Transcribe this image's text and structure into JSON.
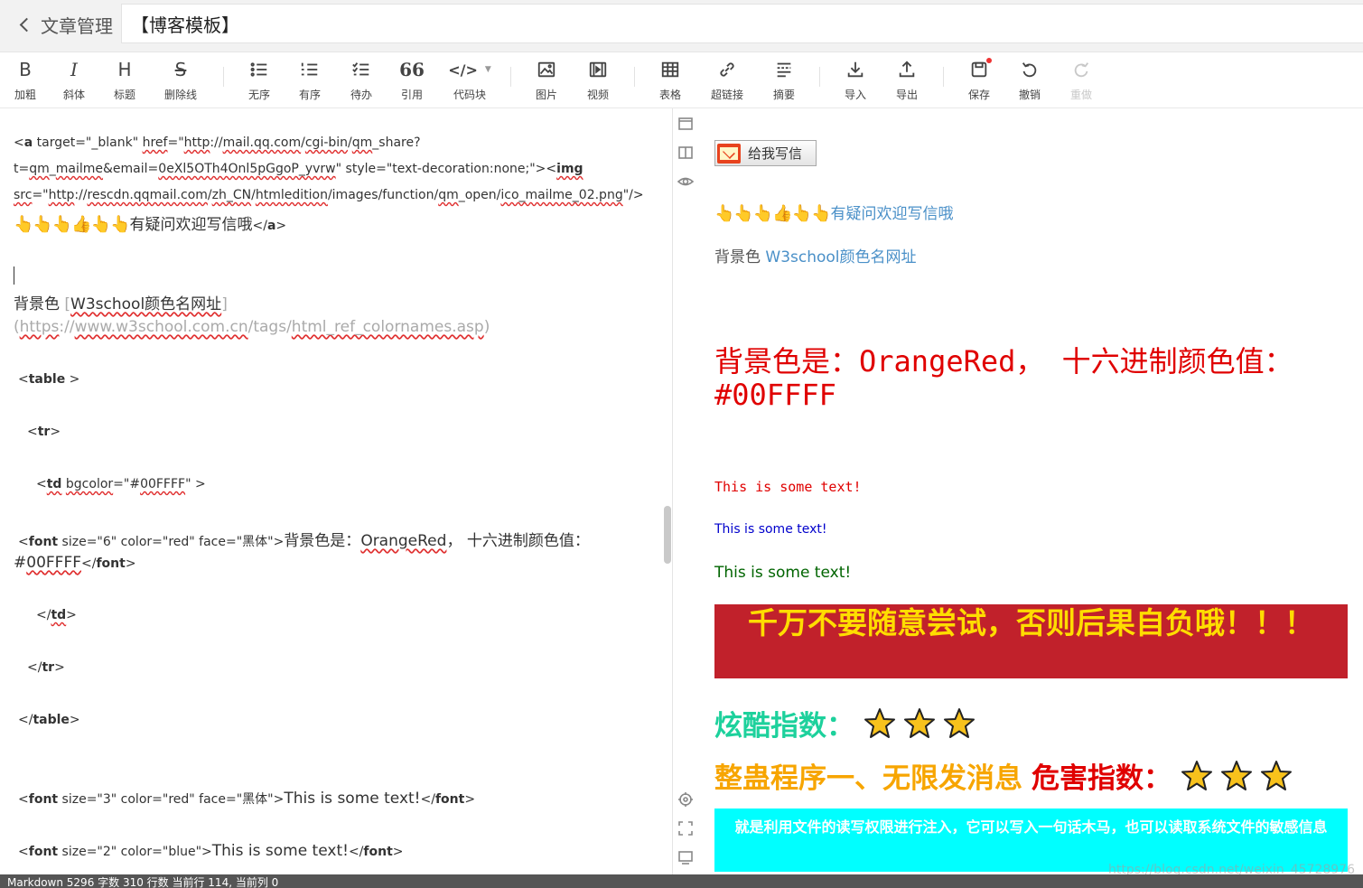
{
  "header": {
    "back_label": "文章管理",
    "title_value": "【博客模板】"
  },
  "toolbar": {
    "bold": "加粗",
    "italic": "斜体",
    "heading": "标题",
    "strike": "删除线",
    "unordered": "无序",
    "ordered": "有序",
    "todo": "待办",
    "quote": "引用",
    "codeblock": "代码块",
    "image": "图片",
    "video": "视频",
    "table": "表格",
    "link": "超链接",
    "summary": "摘要",
    "import": "导入",
    "export": "导出",
    "save": "保存",
    "undo": "撤销",
    "redo": "重做",
    "icon_bold": "B",
    "icon_italic": "I",
    "icon_heading": "H",
    "icon_strike": "S",
    "icon_quote": "66",
    "icon_code": "</>"
  },
  "editor": {
    "l1a": "<",
    "l1b": "a",
    "l1c": " target=\"_blank\" ",
    "l1d": "href",
    "l1e": "=\"",
    "l1f": "http",
    "l1g": "://",
    "l1h": "mail.qq.com",
    "l1i": "/",
    "l1j": "cgi-bin",
    "l1k": "/",
    "l1l": "qm",
    "l1m": "_share?",
    "l2a": "t=",
    "l2b": "qm",
    "l2c": "_",
    "l2d": "mailme",
    "l2e": "&email=",
    "l2f": "0eXl5OTh4Onl5pGgoP_yvrw",
    "l2g": "\" style=\"text-decoration:none;\"><",
    "l2h": "img",
    "l3a": "src",
    "l3b": "=\"",
    "l3c": "http",
    "l3d": "://",
    "l3e": "rescdn.qqmail.com",
    "l3f": "/",
    "l3g": "zh_CN",
    "l3h": "/",
    "l3i": "htmledition",
    "l3j": "/images/function/",
    "l3k": "qm",
    "l3l": "_open/",
    "l3m": "ico_mailme_02.png",
    "l3n": "\"/>",
    "l4_emoji": "👆👆👆👍👆👆",
    "l4_text": "有疑问欢迎写信哦",
    "l4_close": "</",
    "l4_tag": "a",
    "l4_end": ">",
    "l6_a": "背景色 ",
    "l6_b": "[",
    "l6_c": "W3school颜色名网址",
    "l6_d": "]",
    "l7_a": "(",
    "l7_b": "https",
    "l7_c": "://",
    "l7_d": "www.w3school.com.cn",
    "l7_e": "/tags/",
    "l7_f": "html_ref_colornames.asp",
    "l7_g": ")",
    "l8_a": "<",
    "l8_b": "table",
    "l8_c": " >",
    "l9_a": "<",
    "l9_b": "tr",
    "l9_c": ">",
    "l10_a": "<",
    "l10_b": "td",
    "l10_c": " ",
    "l10_d": "bgcolor",
    "l10_e": "=\"#",
    "l10_f": "00FFFF",
    "l10_g": "\" >",
    "l11_a": "<",
    "l11_b": "font",
    "l11_c": " size=\"6\" color=\"red\" face=\"黑体\">",
    "l11_d": "背景色是：",
    "l11_e": "OrangeRed",
    "l11_f": "，  十六进制颜色值：",
    "l12_a": "#",
    "l12_b": "00FFFF",
    "l12_c": "</",
    "l12_d": "font",
    "l12_e": ">",
    "l13_a": "</",
    "l13_b": "td",
    "l13_c": ">",
    "l14_a": "</",
    "l14_b": "tr",
    "l14_c": ">",
    "l15_a": "</",
    "l15_b": "table",
    "l15_c": ">",
    "l16_a": "<",
    "l16_b": "font",
    "l16_c": " size=\"3\" color=\"red\" face=\"黑体\">",
    "l16_d": "This is some text!",
    "l16_e": "</",
    "l16_f": "font",
    "l16_g": ">",
    "l17_a": "<",
    "l17_b": "font",
    "l17_c": " size=\"2\" color=\"blue\">",
    "l17_d": "This is some text!",
    "l17_e": "</",
    "l17_f": "font",
    "l17_g": ">"
  },
  "preview": {
    "mail_button": "给我写信",
    "link_emoji": "👆👆👆👍👆👆",
    "link_text": "有疑问欢迎写信哦",
    "bg_label": "背景色 ",
    "bg_link": "W3school颜色名网址",
    "red_big": "背景色是：OrangeRed，  十六进制颜色值：#00FFFF",
    "text1": "This is some text!",
    "text2": "This is some text!",
    "text3": "This is some text!",
    "warn": "千万不要随意尝试，否则后果自负哦！！！",
    "cool_label": "炫酷指数：",
    "harm_label1": "整蛊程序一、无限发消息",
    "harm_label2": "危害指数：",
    "cyan_text": "就是利用文件的读写权限进行注入，它可以写入一句话木马，也可以读取系统文件的敏感信息"
  },
  "rating": {
    "cool_stars": 3,
    "harm_stars": 3,
    "max": 3
  },
  "status": {
    "text": "Markdown  5296 字数  310 行数  当前行 114, 当前列 0"
  },
  "watermark": "https://blog.csdn.net/weixin_45728976",
  "colors": {
    "red": "#e00000",
    "blue": "#0000cc",
    "green": "#006400",
    "warn_bg": "#c1212b",
    "warn_fg": "#ffdd00",
    "cool": "#1dd19c",
    "harm": "#f7a500",
    "cyan": "#00ffff",
    "link": "#4a90c8"
  }
}
